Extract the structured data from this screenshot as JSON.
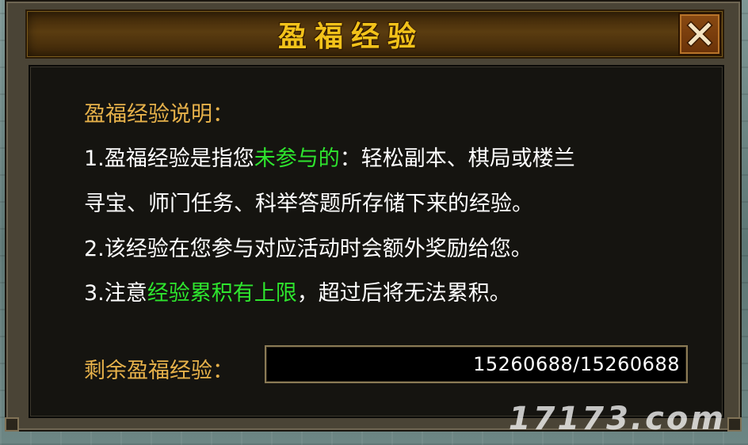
{
  "window": {
    "title": "盈福经验",
    "close_icon": "close-icon"
  },
  "description": {
    "heading": "盈福经验说明：",
    "line1_prefix": "1.盈福经验是指您",
    "line1_highlight": "未参与的",
    "line1_suffix": "：轻松副本、棋局或楼兰",
    "line1_cont": "寻宝、师门任务、科举答题所存储下来的经验。",
    "line2": "2.该经验在您参与对应活动时会额外奖励给您。",
    "line3_prefix": "3.注意",
    "line3_highlight": "经验累积有上限",
    "line3_suffix": "，超过后将无法累积。"
  },
  "remaining": {
    "label": "剩余盈福经验：",
    "value": "15260688/15260688"
  },
  "watermark": "17173.com",
  "colors": {
    "title": "#f2c21a",
    "label": "#e6b14a",
    "highlight": "#2ee52e",
    "text": "#ffffff"
  }
}
